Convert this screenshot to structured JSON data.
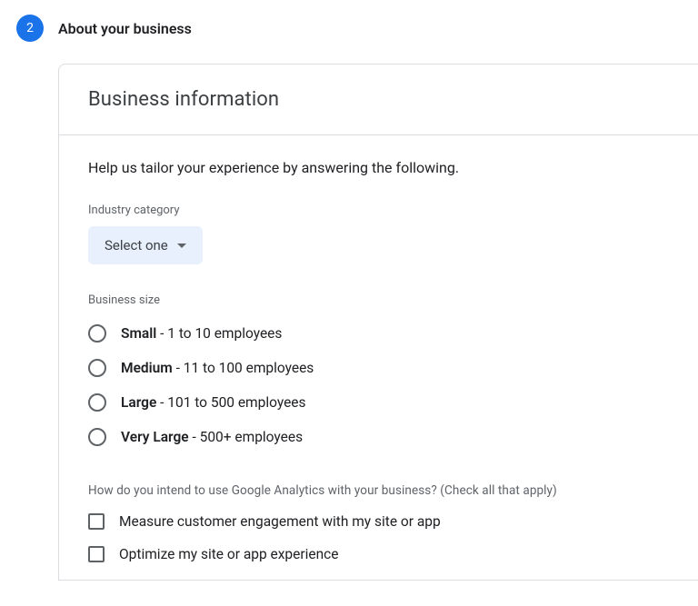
{
  "step": {
    "number": "2",
    "title": "About your business"
  },
  "card": {
    "title": "Business information",
    "intro": "Help us tailor your experience by answering the following."
  },
  "industry": {
    "label": "Industry category",
    "selected": "Select one"
  },
  "size": {
    "label": "Business size",
    "options": [
      {
        "bold": "Small",
        "rest": " - 1 to 10 employees"
      },
      {
        "bold": "Medium",
        "rest": " - 11 to 100 employees"
      },
      {
        "bold": "Large",
        "rest": " - 101 to 500 employees"
      },
      {
        "bold": "Very Large",
        "rest": " - 500+ employees"
      }
    ]
  },
  "usage": {
    "label": "How do you intend to use Google Analytics with your business? (Check all that apply)",
    "options": [
      "Measure customer engagement with my site or app",
      "Optimize my site or app experience"
    ]
  }
}
